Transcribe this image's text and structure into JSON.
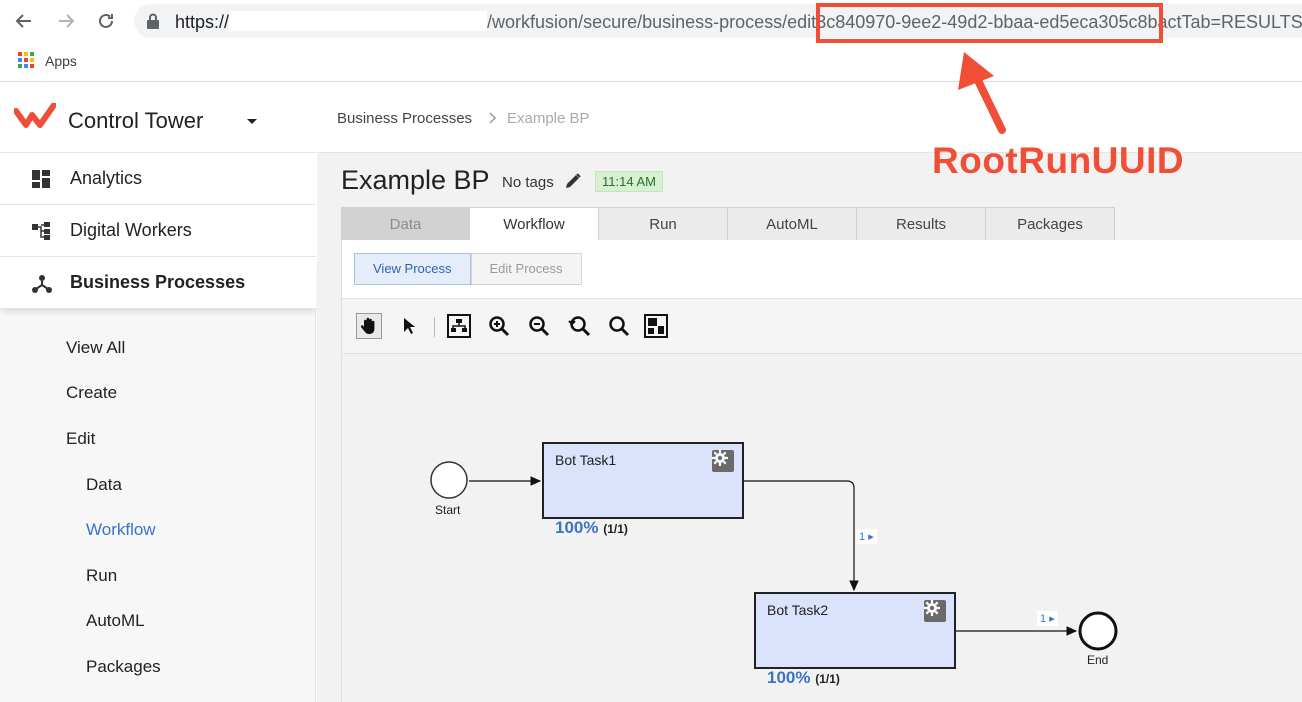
{
  "browser": {
    "url_prefix": "https://",
    "url_path": "/workfusion/secure/business-process/edit",
    "url_uuid": "3c840970-9ee2-49d2-bbaa-ed5eca305c8b",
    "url_suffix": "actTab=RESULTS",
    "bookmark_apps": "Apps",
    "apps_colors": [
      "#ea4335",
      "#fbbc05",
      "#34a853",
      "#4285f4",
      "#ea4335",
      "#fbbc05",
      "#34a853",
      "#4285f4",
      "#ea4335"
    ]
  },
  "sidebar": {
    "brand": "Control Tower",
    "nav": [
      {
        "label": "Analytics",
        "icon": "dashboard-icon"
      },
      {
        "label": "Digital Workers",
        "icon": "hierarchy-icon"
      },
      {
        "label": "Business Processes",
        "icon": "process-icon"
      }
    ],
    "sub_items": [
      "View All",
      "Create",
      "Edit",
      "Data",
      "Workflow",
      "Run",
      "AutoML",
      "Packages"
    ]
  },
  "breadcrumb": {
    "parent": "Business Processes",
    "current": "Example BP"
  },
  "header": {
    "title": "Example BP",
    "tags": "No tags",
    "time": "11:14 AM"
  },
  "tabs": [
    "Data",
    "Workflow",
    "Run",
    "AutoML",
    "Results",
    "Packages"
  ],
  "modes": {
    "view": "View Process",
    "edit": "Edit Process"
  },
  "workflow": {
    "start_label": "Start",
    "end_label": "End",
    "tasks": [
      {
        "name": "Bot Task1",
        "percent": "100%",
        "count": "(1/1)"
      },
      {
        "name": "Bot Task2",
        "percent": "100%",
        "count": "(1/1)"
      }
    ],
    "flow_badge_1": "1",
    "flow_badge_2": "1"
  },
  "annotation": {
    "label": "RootRunUUID",
    "color": "#f04e37"
  },
  "colors": {
    "accent": "#3a73c8",
    "brand": "#f04e37",
    "task_fill": "#dae3fb"
  }
}
